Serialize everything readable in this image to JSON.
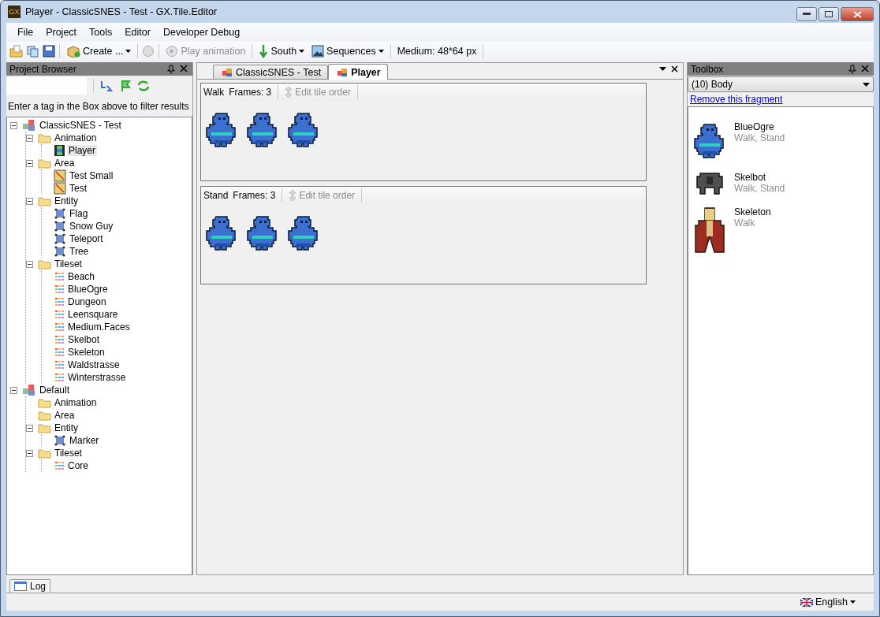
{
  "window": {
    "title": "Player - ClassicSNES - Test - GX.Tile.Editor",
    "logo": "GX"
  },
  "menu": [
    "File",
    "Project",
    "Tools",
    "Editor",
    "Developer Debug"
  ],
  "toolbar": {
    "create": "Create ...",
    "play": {
      "label": "Play animation",
      "disabled": true
    },
    "direction": "South",
    "sequences": "Sequences",
    "size": "Medium: 48*64 px"
  },
  "project_browser": {
    "title": "Project Browser",
    "hint": "Enter a tag in the Box above to filter results",
    "tree": [
      {
        "label": "ClassicSNES - Test",
        "kind": "project",
        "selected": false,
        "expanded": true,
        "children": [
          {
            "label": "Animation",
            "kind": "folder",
            "selected": false,
            "expanded": true,
            "children": [
              {
                "label": "Player",
                "kind": "animation",
                "selected": true
              }
            ]
          },
          {
            "label": "Area",
            "kind": "folder",
            "selected": false,
            "expanded": true,
            "children": [
              {
                "label": "Test Small",
                "kind": "area",
                "selected": false
              },
              {
                "label": "Test",
                "kind": "area",
                "selected": false
              }
            ]
          },
          {
            "label": "Entity",
            "kind": "folder",
            "selected": false,
            "expanded": true,
            "children": [
              {
                "label": "Flag",
                "kind": "entity",
                "selected": false
              },
              {
                "label": "Snow Guy",
                "kind": "entity",
                "selected": false
              },
              {
                "label": "Teleport",
                "kind": "entity",
                "selected": false
              },
              {
                "label": "Tree",
                "kind": "entity",
                "selected": false
              }
            ]
          },
          {
            "label": "Tileset",
            "kind": "folder",
            "selected": false,
            "expanded": true,
            "children": [
              {
                "label": "Beach",
                "kind": "tileset",
                "selected": false
              },
              {
                "label": "BlueOgre",
                "kind": "tileset",
                "selected": false
              },
              {
                "label": "Dungeon",
                "kind": "tileset",
                "selected": false
              },
              {
                "label": "Leensquare",
                "kind": "tileset",
                "selected": false
              },
              {
                "label": "Medium.Faces",
                "kind": "tileset",
                "selected": false
              },
              {
                "label": "Skelbot",
                "kind": "tileset",
                "selected": false
              },
              {
                "label": "Skeleton",
                "kind": "tileset",
                "selected": false
              },
              {
                "label": "Waldstrasse",
                "kind": "tileset",
                "selected": false
              },
              {
                "label": "Winterstrasse",
                "kind": "tileset",
                "selected": false
              }
            ]
          }
        ]
      },
      {
        "label": "Default",
        "kind": "project",
        "selected": false,
        "expanded": true,
        "children": [
          {
            "label": "Animation",
            "kind": "folder",
            "selected": false
          },
          {
            "label": "Area",
            "kind": "folder",
            "selected": false
          },
          {
            "label": "Entity",
            "kind": "folder",
            "selected": false,
            "expanded": true,
            "children": [
              {
                "label": "Marker",
                "kind": "entity",
                "selected": false
              }
            ]
          },
          {
            "label": "Tileset",
            "kind": "folder",
            "selected": false,
            "expanded": true,
            "children": [
              {
                "label": "Core",
                "kind": "tileset",
                "selected": false
              }
            ]
          }
        ]
      }
    ]
  },
  "tabs": [
    {
      "label": "ClassicSNES - Test",
      "selected": false
    },
    {
      "label": "Player",
      "selected": true
    }
  ],
  "sequences": [
    {
      "name": "Walk",
      "frames": "Frames: 3",
      "edit": "Edit tile order",
      "sprites": [
        {
          "kind": "ogre"
        },
        {
          "kind": "ogre"
        },
        {
          "kind": "ogre"
        }
      ]
    },
    {
      "name": "Stand",
      "frames": "Frames: 3",
      "edit": "Edit tile order",
      "sprites": [
        {
          "kind": "ogre"
        },
        {
          "kind": "ogre"
        },
        {
          "kind": "ogre"
        }
      ]
    }
  ],
  "toolbox": {
    "title": "Toolbox",
    "fragment": "(10) Body",
    "remove_link": "Remove this fragment",
    "items": [
      {
        "name": "BlueOgre",
        "tags": "Walk, Stand",
        "kind": "ogre"
      },
      {
        "name": "Skelbot",
        "tags": "Walk, Stand",
        "kind": "robot"
      },
      {
        "name": "Skeleton",
        "tags": "Walk",
        "kind": "caped"
      }
    ]
  },
  "log_tab": "Log",
  "status_bar": {
    "language": "English"
  }
}
